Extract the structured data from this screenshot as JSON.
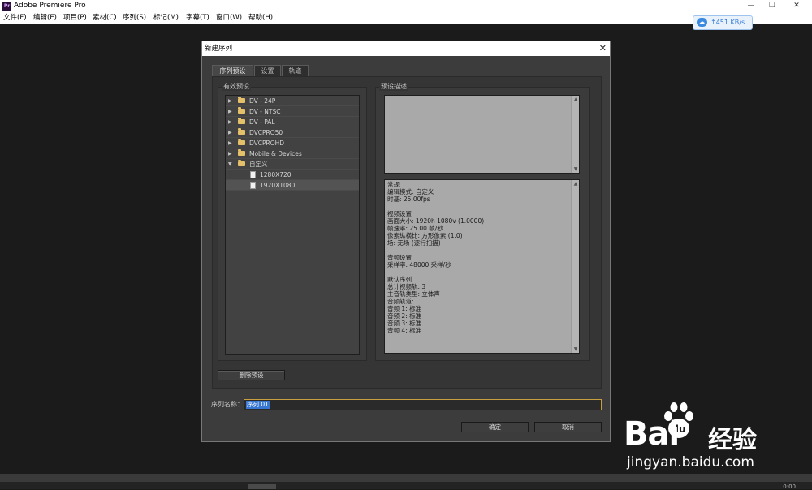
{
  "app": {
    "title": "Adobe Premiere Pro",
    "logo": "Pr",
    "window_buttons": {
      "minimize": "—",
      "restore": "❐",
      "close": "✕"
    }
  },
  "menubar": [
    "文件(F)",
    "编辑(E)",
    "项目(P)",
    "素材(C)",
    "序列(S)",
    "标记(M)",
    "字幕(T)",
    "窗口(W)",
    "帮助(H)"
  ],
  "net_widget": {
    "speed": "↑451 KB/s",
    "icon": "cloud-icon"
  },
  "dialog": {
    "title": "新建序列",
    "close": "✕",
    "tabs": [
      "序列预设",
      "设置",
      "轨道"
    ],
    "presets_label": "有效预设",
    "description_label": "预设描述",
    "tree": [
      {
        "label": "DV - 24P",
        "type": "folder",
        "expanded": false
      },
      {
        "label": "DV - NTSC",
        "type": "folder",
        "expanded": false
      },
      {
        "label": "DV - PAL",
        "type": "folder",
        "expanded": false
      },
      {
        "label": "DVCPRO50",
        "type": "folder",
        "expanded": false
      },
      {
        "label": "DVCPROHD",
        "type": "folder",
        "expanded": false
      },
      {
        "label": "Mobile & Devices",
        "type": "folder",
        "expanded": false
      },
      {
        "label": "自定义",
        "type": "folder",
        "expanded": true
      },
      {
        "label": "1280X720",
        "type": "file"
      },
      {
        "label": "1920X1080",
        "type": "file",
        "selected": true
      }
    ],
    "description_lines": [
      "常规",
      " 编辑模式: 自定义",
      " 时基: 25.00fps",
      "",
      "视频设置",
      " 画面大小: 1920h 1080v (1.0000)",
      " 帧速率: 25.00 帧/秒",
      " 像素纵横比: 方形像素 (1.0)",
      " 场: 无场 (逐行扫描)",
      "",
      "音频设置",
      " 采样率: 48000 采样/秒",
      "",
      "默认序列",
      " 总计视频轨: 3",
      " 主音轨类型: 立体声",
      " 音频轨道:",
      " 音频 1: 标准",
      " 音频 2: 标准",
      " 音频 3: 标准",
      " 音频 4: 标准"
    ],
    "delete_preset_button": "删除预设",
    "sequence_name_label": "序列名称：",
    "sequence_name_value": "序列 01",
    "ok_button": "确定",
    "cancel_button": "取消"
  },
  "bottom_time": "0:00",
  "watermark": {
    "brand_bai": "Bai",
    "brand_du": "du",
    "brand_jy": "经验",
    "url": "jingyan.baidu.com"
  }
}
